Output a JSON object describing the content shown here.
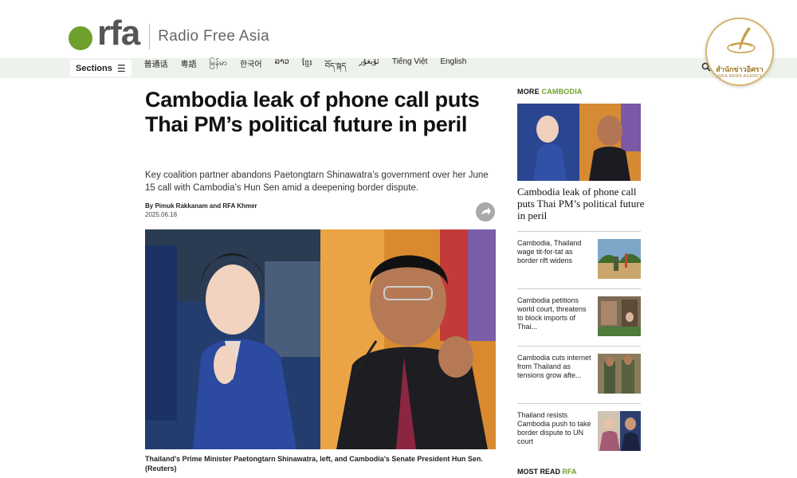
{
  "site": {
    "logo_text": "rfa",
    "name": "Radio Free Asia",
    "brand_color": "#6fa02c"
  },
  "nav": {
    "sections_label": "Sections",
    "languages": [
      "普通话",
      "粵語",
      "မြန်မာ",
      "한국어",
      "ລາວ",
      "ខ្មែរ",
      "བོད་སྐད",
      "ئۇيغۇر",
      "Tiếng Việt",
      "English"
    ]
  },
  "badge": {
    "line1": "สำนักข่าวอิศรา",
    "line2": "ISRA NEWS AGENCY"
  },
  "article": {
    "headline": "Cambodia leak of phone call puts Thai PM’s political future in peril",
    "dek": "Key coalition partner abandons Paetongtarn Shinawatra’s government over her June 15 call with Cambodia’s Hun Sen amid a deepening border dispute.",
    "byline": "By Pimuk Rakkanam and RFA Khmer",
    "date": "2025.06.18",
    "caption": "Thailand's Prime Minister Paetongtarn Shinawatra, left, and Cambodia's Senate President Hun Sen. (Reuters)"
  },
  "sidebar": {
    "more_label": "MORE",
    "more_topic": "CAMBODIA",
    "feature_title": "Cambodia leak of phone call puts Thai PM’s political future in peril",
    "items": [
      {
        "title": "Cambodia, Thailand wage tit-for-tat as border rift widens"
      },
      {
        "title": "Cambodia petitions world court, threatens to block imports of Thai..."
      },
      {
        "title": "Cambodia cuts internet from Thailand as tensions grow afte..."
      },
      {
        "title": "Thailand resists Cambodia push to take border dispute to UN court"
      }
    ],
    "most_read_label": "MOST READ",
    "most_read_brand": "RFA"
  }
}
